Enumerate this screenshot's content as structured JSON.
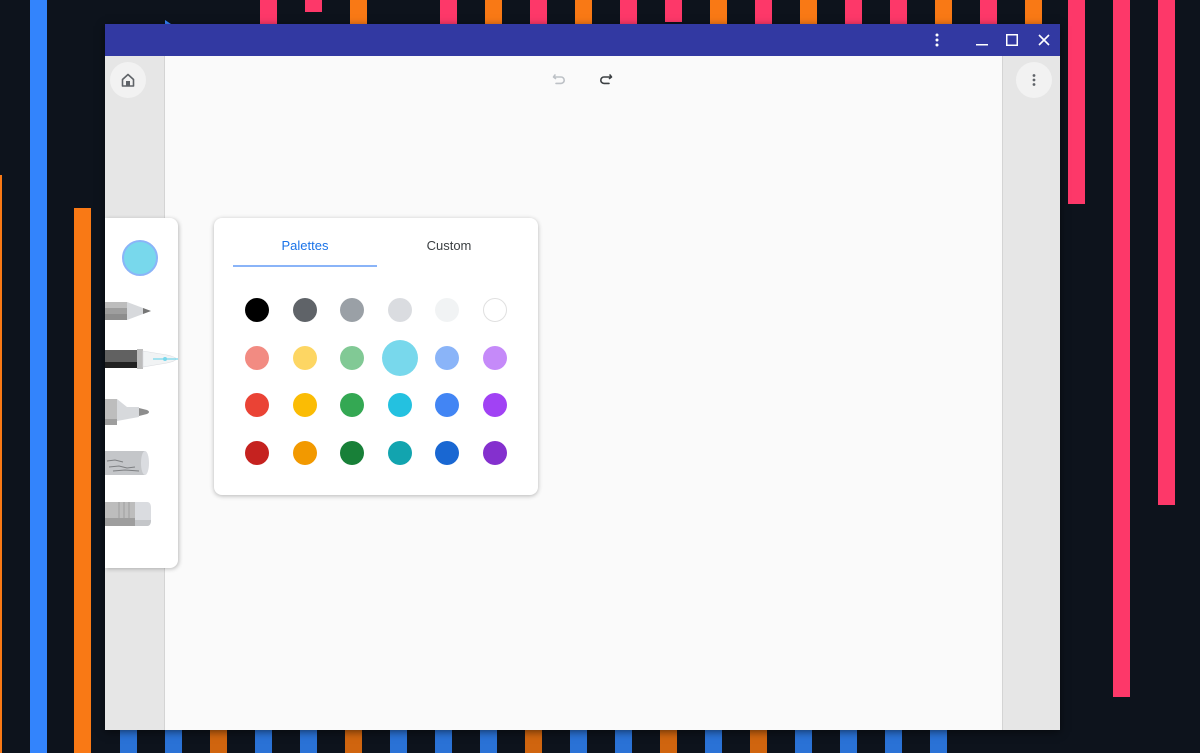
{
  "window": {
    "titlebar": {
      "menu_icon": "more-vert-icon",
      "minimize_icon": "minimize-icon",
      "maximize_icon": "maximize-icon",
      "close_icon": "close-icon"
    },
    "colors": {
      "titlebar": "#3239a2",
      "canvas": "#fafafa",
      "rail": "#e6e6e6",
      "accent": "#1a73e8"
    }
  },
  "left_rail": {
    "home_icon": "home-icon"
  },
  "right_rail": {
    "menu_icon": "more-vert-icon"
  },
  "canvas_toolbar": {
    "undo_icon": "undo-icon",
    "undo_enabled": false,
    "redo_icon": "redo-icon",
    "redo_enabled": true
  },
  "tools": {
    "current_color": "#78d8ec",
    "items": [
      {
        "name": "pencil",
        "icon": "pencil-icon"
      },
      {
        "name": "fountain-pen",
        "icon": "fountain-pen-icon",
        "selected": true
      },
      {
        "name": "marker",
        "icon": "marker-icon"
      },
      {
        "name": "chalk",
        "icon": "chalk-icon"
      },
      {
        "name": "eraser",
        "icon": "eraser-icon"
      }
    ]
  },
  "color_picker": {
    "tabs": [
      {
        "label": "Palettes",
        "active": true
      },
      {
        "label": "Custom",
        "active": false
      }
    ],
    "selected_color": "#78d8ec",
    "rows": [
      [
        "#000000",
        "#5f6368",
        "#9aa0a6",
        "#dadce0",
        "#f1f3f4",
        "#ffffff"
      ],
      [
        "#f28b82",
        "#fdd663",
        "#81c995",
        "#78d8ec",
        "#8ab4f8",
        "#c58af9"
      ],
      [
        "#ea4335",
        "#fbbc04",
        "#34a853",
        "#24c1e0",
        "#4285f4",
        "#a142f4"
      ],
      [
        "#c5221f",
        "#f29900",
        "#188038",
        "#12a4af",
        "#1967d2",
        "#8430ce"
      ]
    ]
  }
}
